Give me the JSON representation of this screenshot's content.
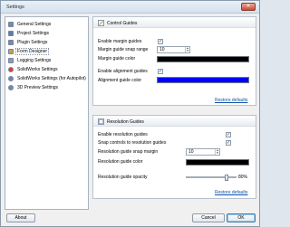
{
  "window": {
    "title": "Settings",
    "close_glyph": "✕"
  },
  "nav": {
    "items": [
      {
        "label": "General Settings",
        "icon": "general-settings-icon",
        "color": "#6d8cb8"
      },
      {
        "label": "Project Settings",
        "icon": "project-settings-icon",
        "color": "#5c7fab"
      },
      {
        "label": "Plugin Settings",
        "icon": "plugin-settings-icon",
        "color": "#7a8aa0"
      },
      {
        "label": "Form Designer",
        "icon": "form-designer-icon",
        "color": "#c8a04a"
      },
      {
        "label": "Logging Settings",
        "icon": "logging-settings-icon",
        "color": "#8b9bb0"
      },
      {
        "label": "SolidWorks Settings",
        "icon": "solidworks-icon",
        "color": "#d04534"
      },
      {
        "label": "SolidWorks Settings (for Autopilot)",
        "icon": "solidworks-autopilot-icon",
        "color": "#6c87b6"
      },
      {
        "label": "3D Preview Settings",
        "icon": "preview-3d-icon",
        "color": "#7289b0"
      }
    ],
    "selected_index": 3
  },
  "control_guides": {
    "title": "Control Guides",
    "enable_margin_label": "Enable margin guides",
    "enable_margin_checked": true,
    "snap_range_label": "Margin guide snap range",
    "snap_range_value": "10",
    "margin_color_label": "Margin guide color",
    "margin_color": "#000000",
    "enable_alignment_label": "Enable alignment guides",
    "enable_alignment_checked": true,
    "alignment_color_label": "Alignment guide color",
    "alignment_color": "#0000ff",
    "restore_label": "Restore defaults"
  },
  "resolution_guides": {
    "title": "Resolution Guides",
    "enable_label": "Enable resolution guides",
    "enable_checked": true,
    "snap_controls_label": "Snap controls to resolution guides",
    "snap_controls_checked": true,
    "snap_margin_label": "Resolution guide snap margin",
    "snap_margin_value": "10",
    "color_label": "Resolution guide color",
    "color": "#000000",
    "opacity_label": "Resolution guide opacity",
    "opacity_value": "80%",
    "opacity_fraction": 0.8,
    "restore_label": "Restore defaults"
  },
  "buttons": {
    "about": "About",
    "cancel": "Cancel",
    "ok": "OK"
  },
  "check_glyph": "✓"
}
